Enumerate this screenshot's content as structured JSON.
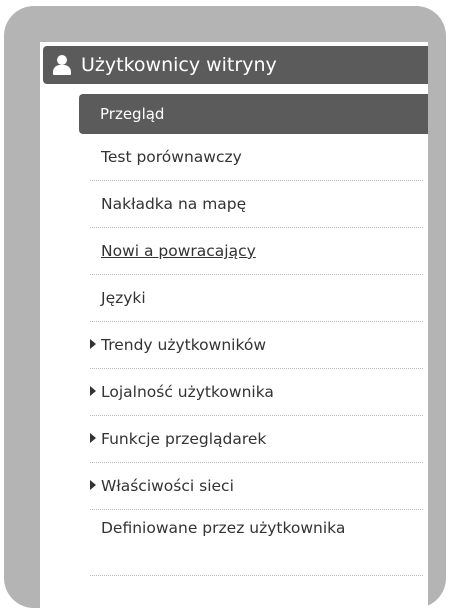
{
  "section": {
    "title": "Użytkownicy witryny",
    "icon": "user-icon"
  },
  "active_item": {
    "label": "Przegląd"
  },
  "items": [
    {
      "label": "Test porównawczy",
      "has_arrow": false,
      "underlined": false
    },
    {
      "label": "Nakładka na mapę",
      "has_arrow": false,
      "underlined": false
    },
    {
      "label": "Nowi a powracający",
      "has_arrow": false,
      "underlined": true
    },
    {
      "label": "Języki",
      "has_arrow": false,
      "underlined": false
    },
    {
      "label": "Trendy użytkowników",
      "has_arrow": true,
      "underlined": false
    },
    {
      "label": "Lojalność użytkownika",
      "has_arrow": true,
      "underlined": false
    },
    {
      "label": "Funkcje przeglądarek",
      "has_arrow": true,
      "underlined": false
    },
    {
      "label": "Właściwości sieci",
      "has_arrow": true,
      "underlined": false
    },
    {
      "label": "Definiowane przez użytkownika",
      "has_arrow": false,
      "underlined": false
    }
  ],
  "colors": {
    "frame": "#b4b4b4",
    "header_bg": "#5b5b5b",
    "text": "#333333"
  }
}
